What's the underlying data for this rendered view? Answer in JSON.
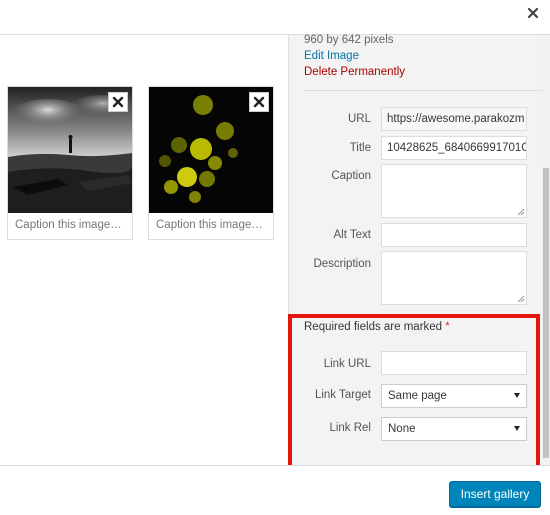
{
  "modal": {
    "close_label": "×"
  },
  "gallery": {
    "items": [
      {
        "caption_placeholder": "Caption this image…"
      },
      {
        "caption_placeholder": "Caption this image…"
      }
    ]
  },
  "details": {
    "dimensions": "960 by 642 pixels",
    "edit_link": "Edit Image",
    "delete_link": "Delete Permanently"
  },
  "fields": {
    "url_label": "URL",
    "url_value": "https://awesome.parakozm",
    "title_label": "Title",
    "title_value": "10428625_684066991701C",
    "caption_label": "Caption",
    "alt_label": "Alt Text",
    "description_label": "Description"
  },
  "display_settings": {
    "required_note": "Required fields are marked",
    "required_mark": "*",
    "link_url_label": "Link URL",
    "link_target_label": "Link Target",
    "link_target_value": "Same page",
    "link_rel_label": "Link Rel",
    "link_rel_value": "None"
  },
  "toolbar": {
    "insert_gallery_label": "Insert gallery"
  },
  "colors": {
    "accent": "#0085ba",
    "link": "#0073aa",
    "delete": "#a00",
    "highlight": "#e3150f",
    "required": "#dc3232"
  }
}
